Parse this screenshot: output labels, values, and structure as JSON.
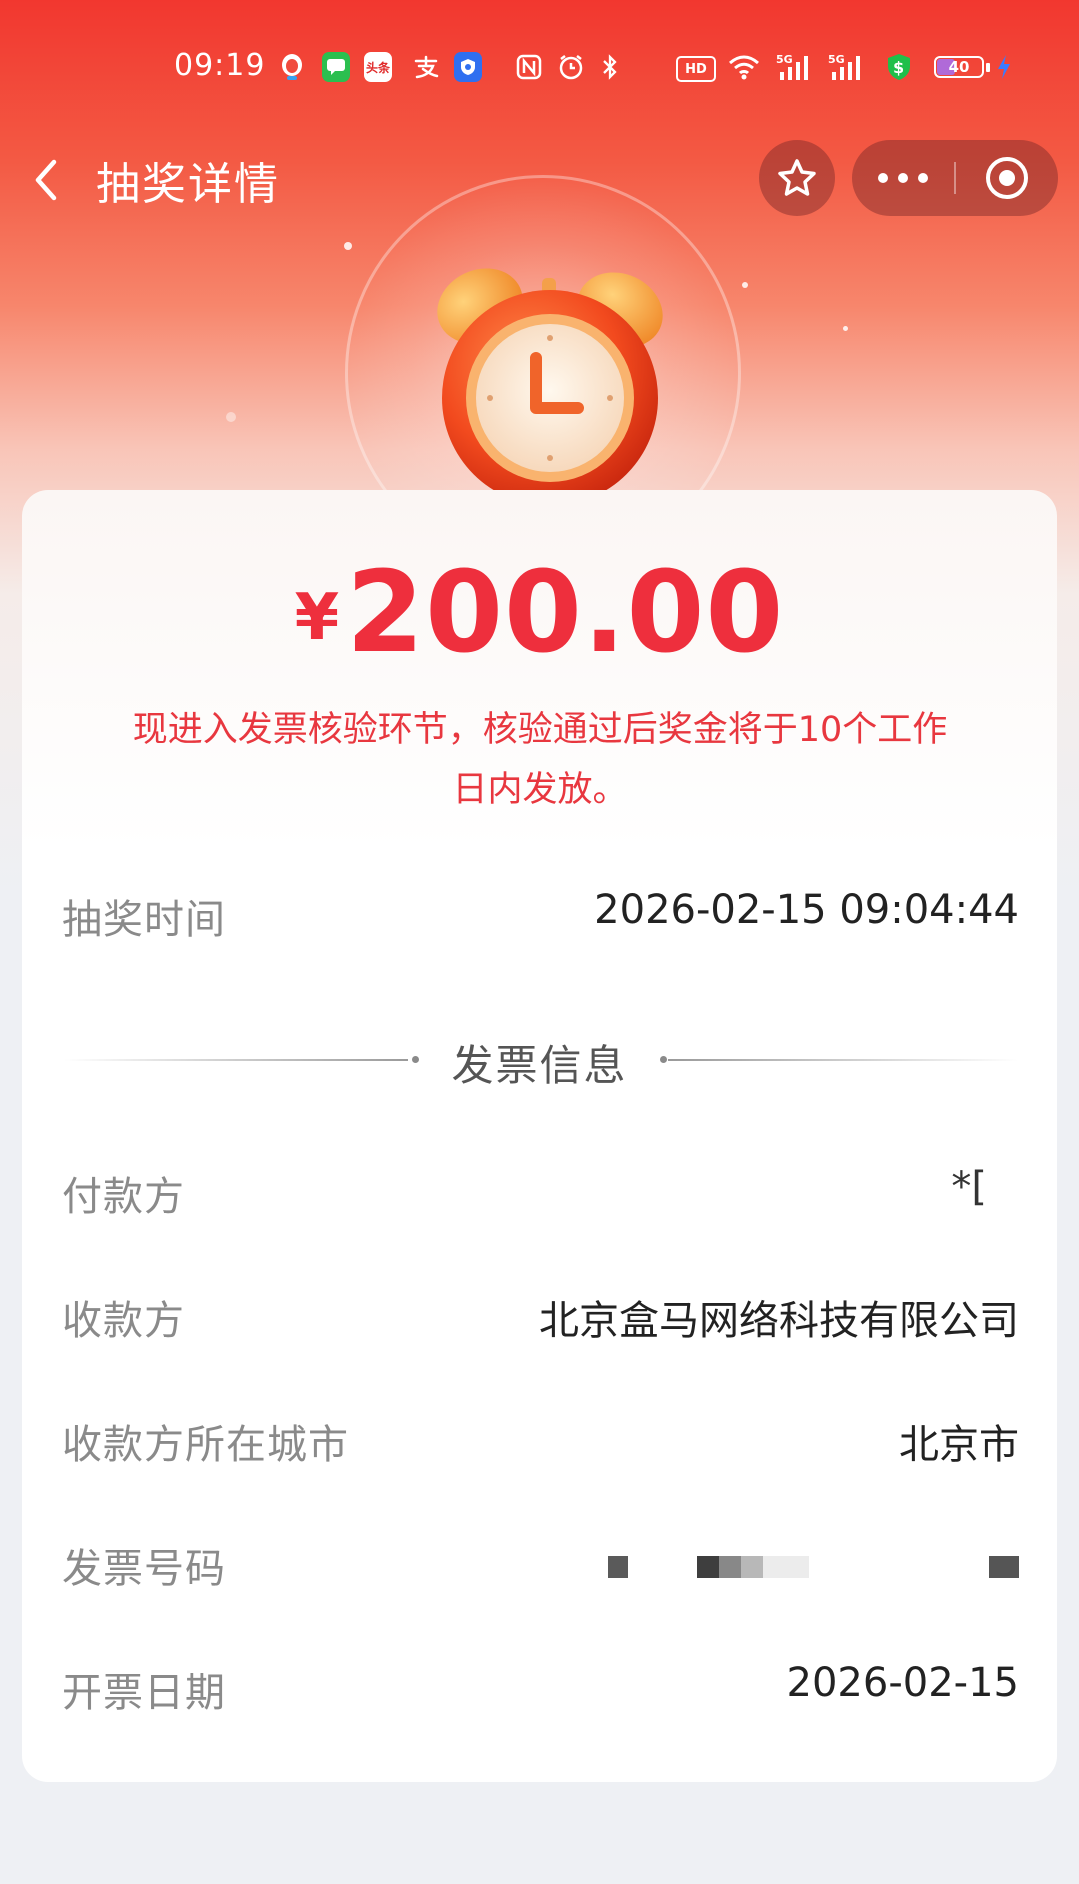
{
  "status_bar": {
    "time": "09:19",
    "battery_level": 40,
    "battery_label": "40",
    "icons": [
      "qq-icon",
      "messages-icon",
      "toutiao-icon",
      "alipay-icon",
      "vpn-shield-icon",
      "nfc-icon",
      "alarm-icon",
      "bluetooth-icon",
      "hd-icon",
      "wifi-icon",
      "signal-5g-icon",
      "signal-5g-icon",
      "money-shield-icon",
      "battery-icon",
      "charging-icon"
    ],
    "hd_label": "HD",
    "net_label": "5G",
    "toutiao_label": "头条"
  },
  "nav": {
    "title": "抽奖详情"
  },
  "prize": {
    "currency": "¥",
    "amount": "200.00",
    "notice": "现进入发票核验环节，核验通过后奖金将于10个工作日内发放。"
  },
  "draw": {
    "time_label": "抽奖时间",
    "time_value": "2026-02-15 09:04:44"
  },
  "invoice": {
    "section_title": "发票信息",
    "payer_label": "付款方",
    "payer_value": "*[",
    "payee_label": "收款方",
    "payee_value": "北京盒马网络科技有限公司",
    "city_label": "收款方所在城市",
    "city_value": "北京市",
    "number_label": "发票号码",
    "date_label": "开票日期",
    "date_value": "2026-02-15"
  },
  "colors": {
    "brand_red": "#f2372f",
    "amount_red": "#ee2f3d",
    "notice_red": "#e8373f"
  }
}
